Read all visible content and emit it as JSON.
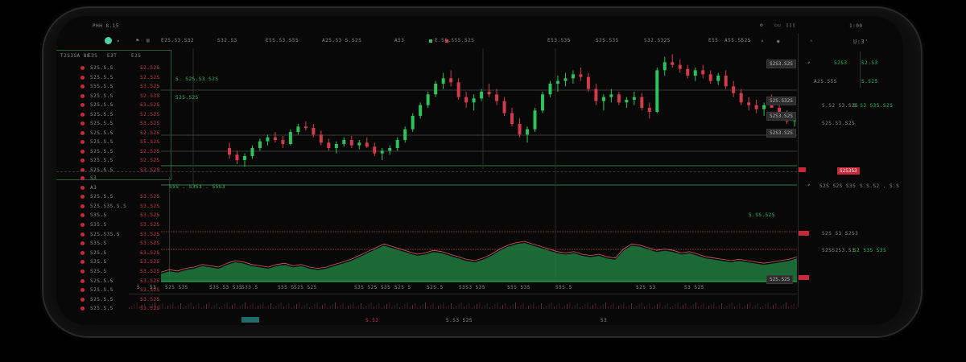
{
  "status_bar": {
    "left": "PHH 8.15",
    "right": "1:00"
  },
  "toolbar": {
    "items": [
      "E2S.S3.S32",
      "S32.S3",
      "E5S.S3.S5S",
      "A2S.S3 S.S2S",
      "A53",
      "E.SS.S5S.S2S",
      "E53.S35",
      "S2S.S3S",
      "S32.S32S",
      "E55",
      "A55.S52S"
    ],
    "item_colors": [
      "#8a8a8a",
      "#8a8a8a",
      "#8a8a8a",
      "#8a8a8a",
      "#8a8a8a",
      "#8a8a8a",
      "#8a8a8a",
      "#8a8a8a",
      "#8a8a8a",
      "#8a8a8a",
      "#8a8a8a"
    ]
  },
  "watchlist": {
    "tabs": [
      "T2S3SA 8F",
      "E3S",
      "E3T",
      "E2S"
    ],
    "top_items": [
      {
        "name": "S2S.S.S",
        "price": "S2.S2S"
      },
      {
        "name": "S2S.S.S",
        "price": "S2.S2S"
      },
      {
        "name": "S5S.S.S",
        "price": "S3.S2S"
      },
      {
        "name": "S2S.S.S",
        "price": "S2.S3S"
      },
      {
        "name": "S2S.S.S",
        "price": "S3.S2S"
      },
      {
        "name": "S2S.S.S",
        "price": "S2.S2S"
      },
      {
        "name": "S2S.S.S",
        "price": "S3.S2S"
      },
      {
        "name": "S2S.S.S",
        "price": "S2.S2S"
      },
      {
        "name": "S2S.S.S",
        "price": "S5.S2S"
      },
      {
        "name": "S2S.S.S",
        "price": "S2.S2S"
      },
      {
        "name": "S2S.S.S",
        "price": "S2.S2S"
      },
      {
        "name": "S2S.S.S",
        "price": "S3.S2S"
      }
    ],
    "bottom_items": [
      {
        "name": "S3",
        "price": ""
      },
      {
        "name": "A3",
        "price": ""
      },
      {
        "name": "S2S.S.S",
        "price": "S3.S2S"
      },
      {
        "name": "S2S.S3S.S.S",
        "price": "S3.S2S"
      },
      {
        "name": "S3S.S",
        "price": "S3.S2S"
      },
      {
        "name": "S3S.S",
        "price": "S3.S2S"
      },
      {
        "name": "S2S.S3S.S",
        "price": "S3.S2S"
      },
      {
        "name": "S3S.S",
        "price": "S3.S2S"
      },
      {
        "name": "S2S.S",
        "price": "S3.S2S"
      },
      {
        "name": "S3S.S",
        "price": "S3.S2S"
      },
      {
        "name": "S2S.S",
        "price": "S3.S2S"
      },
      {
        "name": "S2S.S.S",
        "price": "S3.S2S"
      },
      {
        "name": "S2S.S.S",
        "price": "S3.S2S"
      },
      {
        "name": "S2S.S.S",
        "price": "S3.S2S"
      },
      {
        "name": "S2S.S.S",
        "price": "S3.S2S"
      }
    ]
  },
  "chart": {
    "annotations": [
      "S. S2S.S3 S2S",
      "S2S.S2S",
      "S5S . S3S3 . S5S3",
      "S.SS.S2S"
    ],
    "price_tags": [
      "S2S3.S2S",
      "S2S.S32S",
      "S2S3.S2S",
      "S2S3.S2S",
      "S2S.S2S",
      "S2S.S2S"
    ],
    "time_labels": [
      "S",
      "S3",
      "S2S S3S",
      "S3S.S3 S3S",
      "S33.S",
      "S5S S",
      "S2S S2S",
      "S3S S2S S3S",
      "S2S S",
      "S2S.S",
      "S3S3 S3S",
      "S5S S3S",
      "S5S.S",
      "S2S S3",
      "S3 S2S"
    ],
    "bottom_labels": [
      "S.S2",
      "S.S3 S2S",
      "S3"
    ]
  },
  "right_panel": {
    "title": "U:3'",
    "rows": [
      {
        "label": "S2S3",
        "value": "S2.S3"
      },
      {
        "label": "A2S.S5S",
        "value": "S.S2S"
      },
      {
        "label": "S.S2 S3.S2S",
        "value": "S S3 S3S.S2S"
      },
      {
        "label": "S2S.S3.S2S",
        "value": ""
      },
      {
        "label": "S2S S2S S3S",
        "value": "S.S.S2 . S.S"
      },
      {
        "label": "S2S S3 S2S3",
        "value": ""
      },
      {
        "label": "S2SS2S3.S3",
        "value": "S2 S3S S3S"
      }
    ],
    "badge": "S2S3S3"
  },
  "candles": [
    [
      108,
      112,
      100,
      103
    ],
    [
      103,
      106,
      96,
      99
    ],
    [
      99,
      104,
      94,
      102
    ],
    [
      102,
      110,
      100,
      108
    ],
    [
      108,
      115,
      106,
      113
    ],
    [
      113,
      118,
      110,
      116
    ],
    [
      116,
      120,
      112,
      114
    ],
    [
      114,
      117,
      108,
      111
    ],
    [
      111,
      122,
      110,
      120
    ],
    [
      120,
      126,
      118,
      124
    ],
    [
      124,
      128,
      121,
      123
    ],
    [
      123,
      126,
      116,
      118
    ],
    [
      118,
      121,
      110,
      112
    ],
    [
      112,
      115,
      106,
      108
    ],
    [
      108,
      113,
      104,
      111
    ],
    [
      111,
      116,
      109,
      114
    ],
    [
      114,
      117,
      108,
      110
    ],
    [
      110,
      114,
      107,
      112
    ],
    [
      112,
      116,
      108,
      109
    ],
    [
      109,
      112,
      102,
      104
    ],
    [
      104,
      108,
      99,
      106
    ],
    [
      106,
      110,
      103,
      108
    ],
    [
      108,
      116,
      106,
      114
    ],
    [
      114,
      124,
      112,
      122
    ],
    [
      122,
      134,
      120,
      132
    ],
    [
      132,
      142,
      130,
      140
    ],
    [
      140,
      150,
      138,
      148
    ],
    [
      148,
      158,
      146,
      156
    ],
    [
      156,
      164,
      152,
      160
    ],
    [
      160,
      166,
      154,
      157
    ],
    [
      157,
      160,
      144,
      146
    ],
    [
      146,
      150,
      138,
      142
    ],
    [
      142,
      148,
      136,
      145
    ],
    [
      145,
      152,
      143,
      150
    ],
    [
      150,
      156,
      146,
      148
    ],
    [
      148,
      152,
      140,
      143
    ],
    [
      143,
      146,
      132,
      134
    ],
    [
      134,
      138,
      124,
      126
    ],
    [
      126,
      130,
      116,
      118
    ],
    [
      118,
      124,
      112,
      122
    ],
    [
      122,
      138,
      120,
      136
    ],
    [
      136,
      150,
      134,
      148
    ],
    [
      148,
      158,
      146,
      156
    ],
    [
      156,
      162,
      150,
      158
    ],
    [
      158,
      164,
      154,
      160
    ],
    [
      160,
      166,
      156,
      163
    ],
    [
      163,
      168,
      158,
      161
    ],
    [
      161,
      164,
      150,
      152
    ],
    [
      152,
      156,
      140,
      143
    ],
    [
      143,
      148,
      136,
      146
    ],
    [
      146,
      152,
      142,
      148
    ],
    [
      148,
      150,
      140,
      142
    ],
    [
      142,
      146,
      138,
      144
    ],
    [
      144,
      150,
      140,
      146
    ],
    [
      146,
      149,
      136,
      138
    ],
    [
      138,
      142,
      130,
      135
    ],
    [
      135,
      168,
      134,
      166
    ],
    [
      166,
      176,
      162,
      172
    ],
    [
      172,
      178,
      168,
      170
    ],
    [
      170,
      174,
      164,
      167
    ],
    [
      167,
      170,
      160,
      162
    ],
    [
      162,
      168,
      158,
      166
    ],
    [
      166,
      170,
      160,
      163
    ],
    [
      163,
      166,
      156,
      158
    ],
    [
      158,
      164,
      155,
      162
    ],
    [
      162,
      166,
      152,
      154
    ],
    [
      154,
      158,
      146,
      149
    ],
    [
      149,
      152,
      140,
      142
    ],
    [
      142,
      146,
      136,
      140
    ],
    [
      140,
      144,
      134,
      137
    ],
    [
      137,
      142,
      132,
      140
    ],
    [
      140,
      148,
      138,
      138
    ],
    [
      138,
      142,
      130,
      132
    ],
    [
      132,
      136,
      126,
      128
    ],
    [
      128,
      134,
      124,
      131
    ],
    [
      131,
      136,
      128,
      134
    ],
    [
      134,
      138,
      130,
      136
    ],
    [
      136,
      148,
      134,
      146
    ]
  ],
  "volume": [
    6,
    8,
    7,
    9,
    10,
    12,
    11,
    10,
    13,
    15,
    14,
    12,
    11,
    10,
    12,
    13,
    11,
    12,
    10,
    9,
    10,
    12,
    14,
    16,
    19,
    22,
    25,
    28,
    26,
    24,
    22,
    20,
    21,
    23,
    22,
    20,
    18,
    16,
    15,
    17,
    20,
    24,
    27,
    29,
    30,
    28,
    26,
    24,
    22,
    21,
    22,
    20,
    19,
    20,
    18,
    17,
    24,
    28,
    27,
    25,
    23,
    24,
    23,
    21,
    22,
    20,
    18,
    17,
    16,
    15,
    16,
    15,
    14,
    13,
    14,
    15,
    16,
    18
  ]
}
